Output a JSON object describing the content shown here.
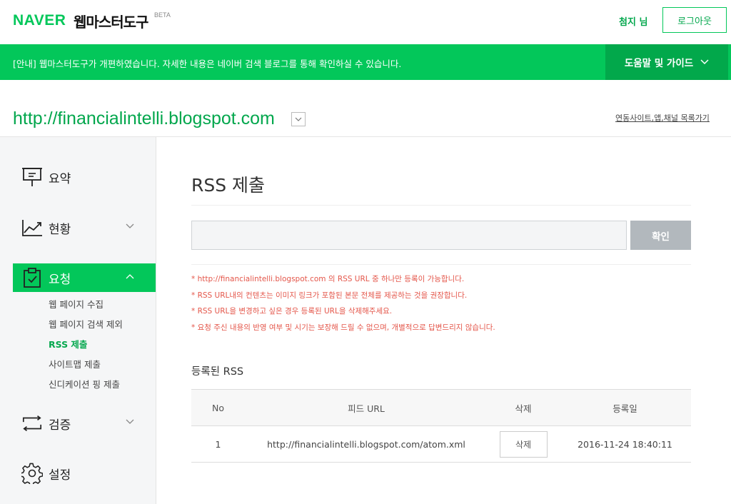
{
  "header": {
    "logo": "NAVER",
    "title": "웹마스터도구",
    "beta": "BETA",
    "user_name": "첨지 님",
    "logout_label": "로그아웃"
  },
  "notice": {
    "text": "[안내] 웹마스터도구가 개편하였습니다. 자세한 내용은 네이버 검색 블로그를 통해 확인하실 수 있습니다.",
    "guide_label": "도움말 및 가이드"
  },
  "site": {
    "url": "http://financialintelli.blogspot.com",
    "link_label": "연동사이트,앱,채널 목록가기"
  },
  "sidebar": {
    "items": [
      {
        "label": "요약"
      },
      {
        "label": "현황"
      },
      {
        "label": "요청"
      },
      {
        "label": "검증"
      },
      {
        "label": "설정"
      }
    ],
    "submenu": [
      {
        "label": "웹 페이지 수집"
      },
      {
        "label": "웹 페이지 검색 제외"
      },
      {
        "label": "RSS 제출"
      },
      {
        "label": "사이트맵 제출"
      },
      {
        "label": "신디케이션 핑 제출"
      }
    ]
  },
  "main": {
    "title": "RSS 제출",
    "input_value": "",
    "confirm_label": "확인",
    "notes": [
      "* http://financialintelli.blogspot.com 의 RSS URL 중 하나만 등록이 가능합니다.",
      "* RSS URL내의 컨텐츠는 이미지 링크가 포함된 본문 전체를 제공하는 것을 권장합니다.",
      "* RSS URL을 변경하고 싶은 경우 등록된 URL을 삭제해주세요.",
      "* 요청 주신 내용의 반영 여부 및 시기는 보장해 드릴 수 없으며, 개별적으로 답변드리지 않습니다."
    ],
    "section_title": "등록된 RSS",
    "table": {
      "headers": [
        "No",
        "피드 URL",
        "삭제",
        "등록일"
      ],
      "rows": [
        {
          "no": "1",
          "url": "http://financialintelli.blogspot.com/atom.xml",
          "delete_label": "삭제",
          "date": "2016-11-24 18:40:11"
        }
      ]
    }
  },
  "colors": {
    "brand": "#03c75a",
    "brand_dark": "#02a84b",
    "note_red": "#e4564a",
    "button_gray": "#b2b8bd"
  }
}
